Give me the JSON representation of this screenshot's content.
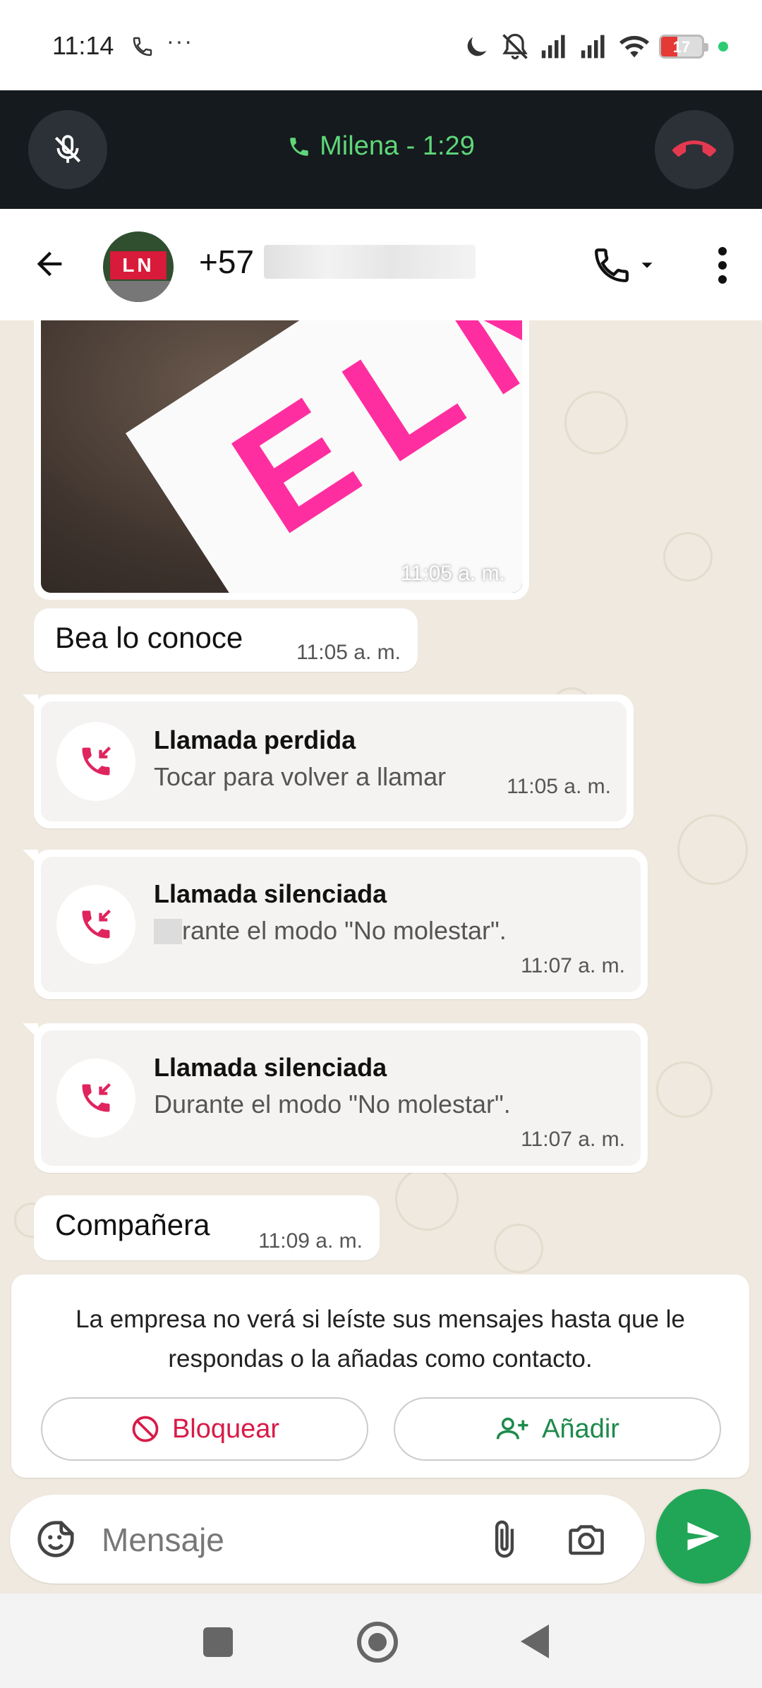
{
  "status_bar": {
    "time": "11:14",
    "dots": "···",
    "battery_level": "17"
  },
  "call_banner": {
    "title": "Milena - 1:29"
  },
  "chat_header": {
    "contact_prefix": "+57"
  },
  "messages": {
    "image_time": "11:05 a. m.",
    "text1": {
      "text": "Bea lo conoce",
      "time": "11:05 a. m."
    },
    "call1": {
      "title": "Llamada perdida",
      "subtitle": "Tocar para volver a llamar",
      "time": "11:05 a. m."
    },
    "call2": {
      "title": "Llamada silenciada",
      "subtitle": "rante el modo \"No molestar\".",
      "time": "11:07 a. m."
    },
    "call3": {
      "title": "Llamada silenciada",
      "subtitle": "Durante el modo \"No molestar\".",
      "time": "11:07 a. m."
    },
    "text2": {
      "text": "Compañera",
      "time": "11:09 a. m."
    }
  },
  "notice": {
    "text": "La empresa no verá si leíste sus mensajes hasta que le respondas o la añadas como contacto.",
    "block_label": "Bloquear",
    "add_label": "Añadir"
  },
  "input": {
    "placeholder": "Mensaje"
  },
  "colors": {
    "call_green": "#5fd679",
    "hangup_red": "#e53950",
    "missed_red": "#e0245e",
    "send_green": "#21a657",
    "block_red": "#d81b47",
    "add_green": "#1e8a4c"
  }
}
